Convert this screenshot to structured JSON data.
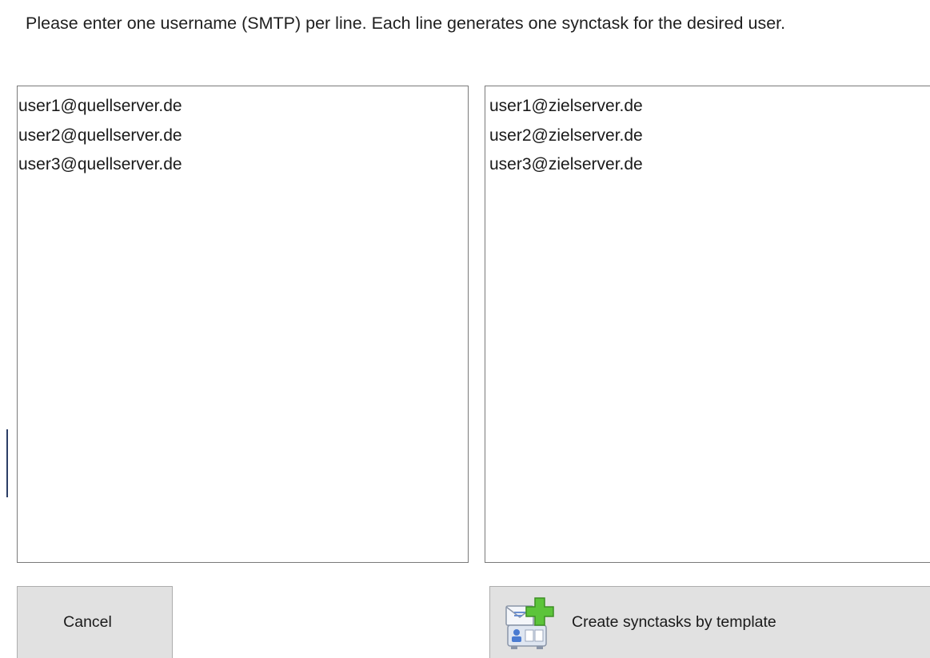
{
  "instructions": "Please enter one username (SMTP) per line. Each line generates one synctask for the desired user.",
  "source_list": {
    "lines": [
      "user1@quellserver.de",
      "user2@quellserver.de",
      "user3@quellserver.de"
    ]
  },
  "target_list": {
    "lines": [
      "user1@zielserver.de",
      "user2@zielserver.de",
      "user3@zielserver.de"
    ]
  },
  "buttons": {
    "cancel_label": "Cancel",
    "create_label": "Create synctasks by template",
    "create_icon": "template-add-icon"
  },
  "colors": {
    "button_bg": "#e1e1e1",
    "button_border": "#adadad",
    "textbox_border": "#7a7a7a",
    "plus_green": "#5cc43a"
  }
}
